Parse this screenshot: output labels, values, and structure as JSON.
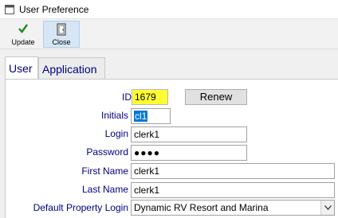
{
  "window": {
    "title": "User Preference"
  },
  "toolbar": {
    "update_label": "Update",
    "close_label": "Close"
  },
  "tabs": [
    {
      "label": "User"
    },
    {
      "label": "Application"
    }
  ],
  "form": {
    "id": {
      "label": "ID",
      "value": "1679"
    },
    "renew_label": "Renew",
    "initials": {
      "label": "Initials",
      "value": "cl1"
    },
    "login": {
      "label": "Login",
      "value": "clerk1"
    },
    "password": {
      "label": "Password",
      "value": "●●●●"
    },
    "first_name": {
      "label": "First Name",
      "value": "clerk1"
    },
    "last_name": {
      "label": "Last Name",
      "value": "clerk1"
    },
    "default_property": {
      "label": "Default Property Login",
      "value": "Dynamic RV Resort and Marina"
    }
  },
  "colors": {
    "label_text": "#000080",
    "highlight": "#ffff33",
    "selection": "#0078d7"
  },
  "icons": {
    "app": "window-icon",
    "update": "checkmark-icon",
    "close": "door-icon"
  }
}
